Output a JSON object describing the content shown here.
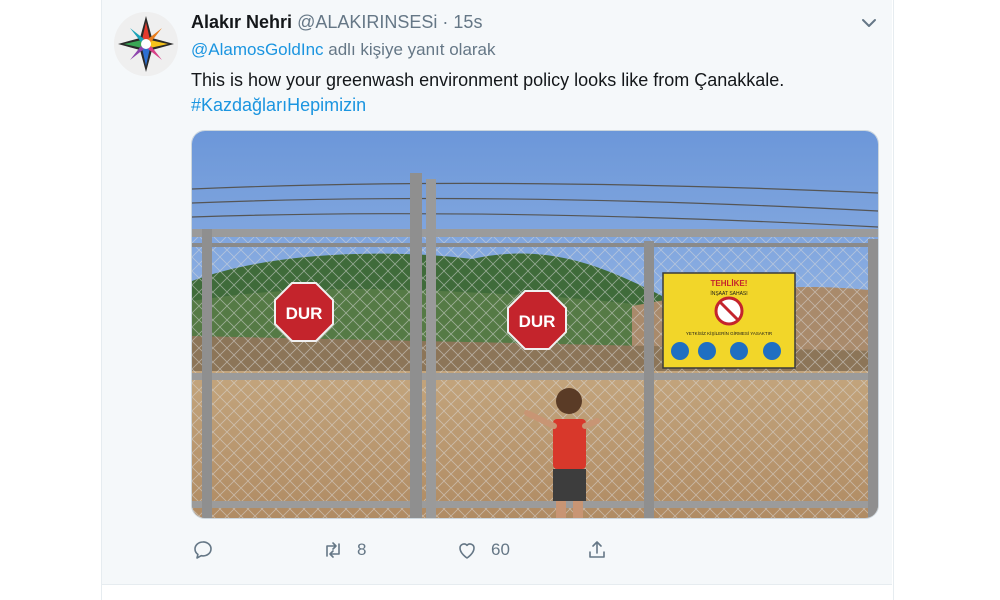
{
  "tweet": {
    "display_name": "Alakır Nehri",
    "handle": "@ALAKIRINSESi",
    "separator": "·",
    "time": "15s",
    "reply_to_handle": "@AlamosGoldInc",
    "reply_suffix": "adlı kişiye yanıt olarak",
    "text": "This is how your greenwash environment policy looks like from Çanakkale.",
    "hashtag": "#KazdağlarıHepimizin",
    "photo": {
      "signs": [
        "DUR",
        "DUR"
      ],
      "warning_sign_title": "TEHLİKE!",
      "warning_sign_subtitle": "İNŞAAT SAHASI",
      "warning_sign_text": "YETKİSİZ KİŞİLERİN GİRMESİ YASAKTIR"
    }
  },
  "actions": {
    "reply_icon": "reply-icon",
    "retweet_icon": "retweet-icon",
    "retweet_count": "8",
    "like_icon": "heart-icon",
    "like_count": "60",
    "share_icon": "share-icon"
  },
  "colors": {
    "link": "#1b95e0",
    "muted": "#657786",
    "text": "#14171a",
    "background": "#f5f8fa"
  }
}
